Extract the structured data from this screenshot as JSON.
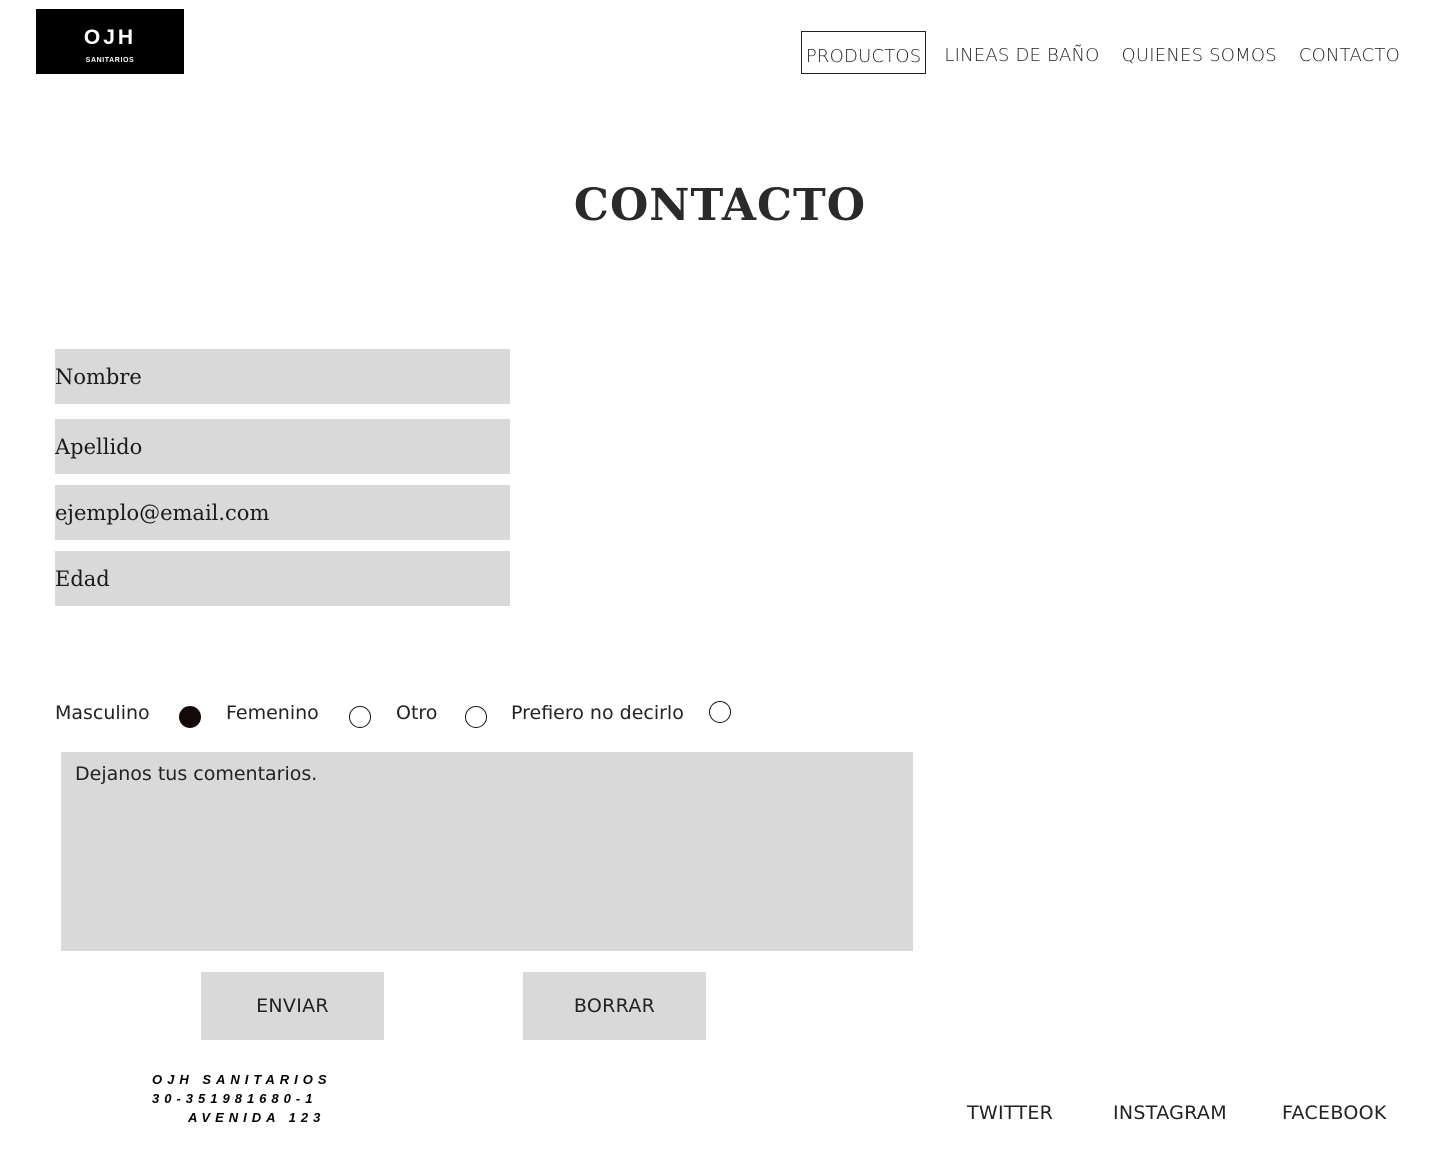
{
  "brand": {
    "logo_main": "OJH",
    "logo_sub": "SANITARIOS"
  },
  "nav": {
    "items": [
      {
        "label": "PRODUCTOS",
        "active": true
      },
      {
        "label": "LINEAS DE BAÑO",
        "active": false
      },
      {
        "label": "QUIENES SOMOS",
        "active": false
      },
      {
        "label": "CONTACTO",
        "active": false
      }
    ]
  },
  "page": {
    "title": "CONTACTO"
  },
  "form": {
    "name_placeholder": "Nombre",
    "lastname_placeholder": "Apellido",
    "email_placeholder": "ejemplo@email.com",
    "age_placeholder": "Edad",
    "gender_options": [
      {
        "label": "Masculino",
        "checked": true
      },
      {
        "label": "Femenino",
        "checked": false
      },
      {
        "label": "Otro",
        "checked": false
      },
      {
        "label": "Prefiero no decirlo",
        "checked": false
      }
    ],
    "comments_placeholder": "Dejanos tus comentarios.",
    "submit_label": "ENVIAR",
    "reset_label": "BORRAR"
  },
  "footer": {
    "company": "OJH SANITARIOS",
    "phone": "30-351981680-1",
    "address": "AVENIDA 123",
    "social": {
      "twitter": "TWITTER",
      "instagram": "INSTAGRAM",
      "facebook": "FACEBOOK"
    }
  },
  "colors": {
    "field_bg": "#d9d9d9",
    "text": "#222222",
    "logo_bg": "#000000",
    "radio_checked": "#150808"
  }
}
